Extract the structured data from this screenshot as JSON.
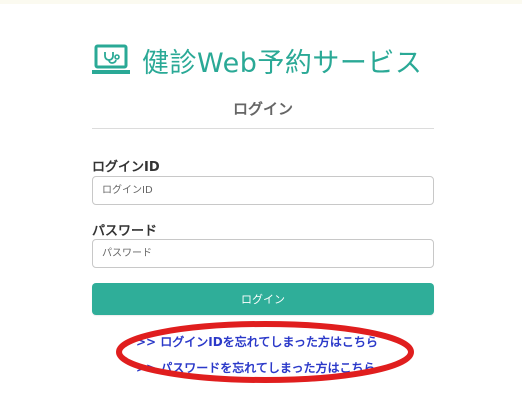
{
  "header": {
    "app_title": "健診Web予約サービス",
    "logo_icon": "stethoscope-laptop-icon"
  },
  "login": {
    "page_title": "ログイン",
    "id_label": "ログインID",
    "id_placeholder": "ログインID",
    "password_label": "パスワード",
    "password_placeholder": "パスワード",
    "submit_label": "ログイン"
  },
  "links": {
    "forgot_id": ">> ログインIDを忘れてしまった方はこちら",
    "forgot_password": ">> パスワードを忘れてしまった方はこちら"
  },
  "colors": {
    "accent": "#2aa996",
    "button": "#2fae99",
    "link": "#2b39c9",
    "annotation": "#e01e1e"
  }
}
